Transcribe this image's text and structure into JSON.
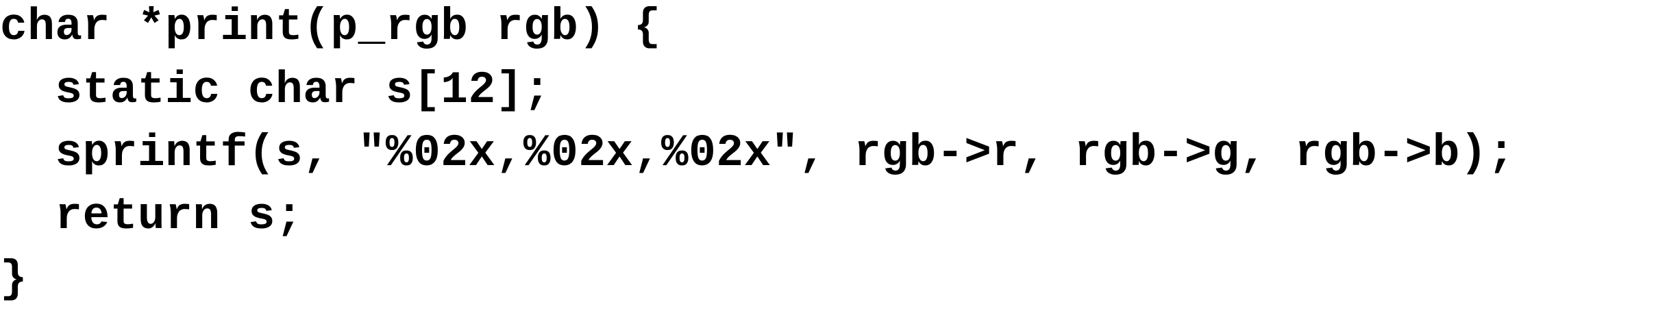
{
  "code": {
    "lines": [
      "char *print(p_rgb rgb) {",
      "  static char s[12];",
      "  sprintf(s, \"%02x,%02x,%02x\", rgb->r, rgb->g, rgb->b);",
      "  return s;",
      "}"
    ]
  }
}
